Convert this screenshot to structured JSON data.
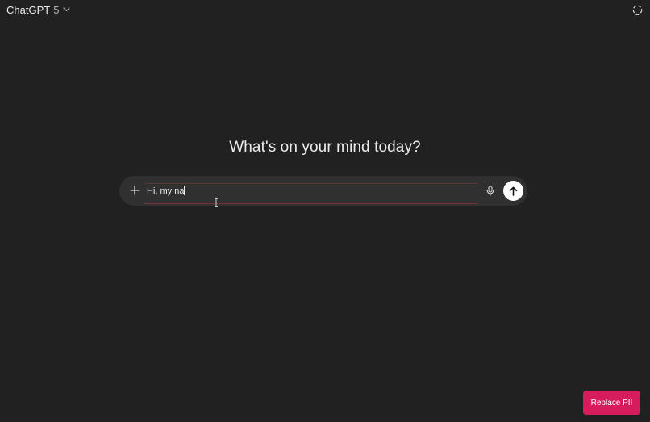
{
  "header": {
    "model_name": "ChatGPT",
    "model_version": "5",
    "icons": {
      "model_dropdown": "chevron-down-icon",
      "temporary_chat": "dashed-circle-icon"
    }
  },
  "main": {
    "headline": "What's on your mind today?"
  },
  "composer": {
    "input_value": "Hi, my na",
    "icons": {
      "add": "plus-icon",
      "voice": "microphone-icon",
      "send": "arrow-up-icon"
    }
  },
  "footer": {
    "replace_pii_label": "Replace PII"
  },
  "colors": {
    "background": "#212121",
    "composer_background": "#303030",
    "text": "#ececec",
    "replace_pii_button": "#d61c5c",
    "send_button": "#ffffff"
  }
}
